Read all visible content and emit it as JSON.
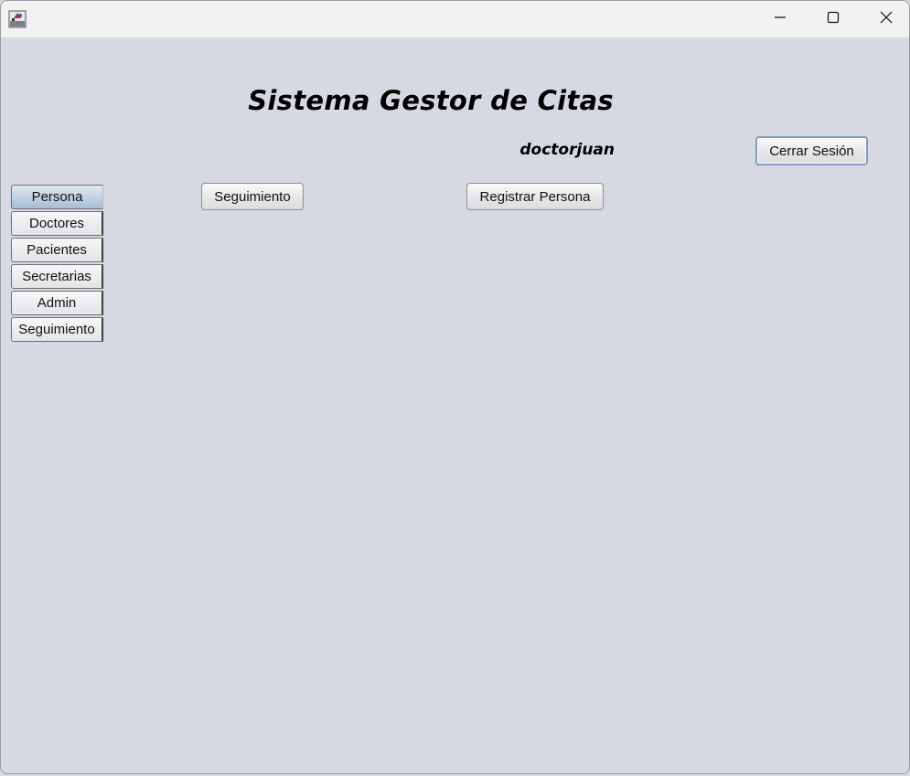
{
  "window": {
    "title": "",
    "controls": {
      "minimize_icon": "minimize-icon",
      "maximize_icon": "maximize-icon",
      "close_icon": "close-icon"
    }
  },
  "header": {
    "title": "Sistema Gestor de Citas",
    "username": "doctorjuan",
    "logout_label": "Cerrar Sesión"
  },
  "sidebar": {
    "tabs": [
      {
        "label": "Persona",
        "active": true
      },
      {
        "label": "Doctores",
        "active": false
      },
      {
        "label": "Pacientes",
        "active": false
      },
      {
        "label": "Secretarias",
        "active": false
      },
      {
        "label": "Admin",
        "active": false
      },
      {
        "label": "Seguimiento",
        "active": false
      }
    ]
  },
  "main": {
    "seguimiento_label": "Seguimiento",
    "registrar_label": "Registrar Persona"
  },
  "colors": {
    "background": "#d6d9e1",
    "titlebar": "#f2f2f2",
    "active_tab": "#a7bdd4",
    "focus_border": "#7e9bc0"
  }
}
